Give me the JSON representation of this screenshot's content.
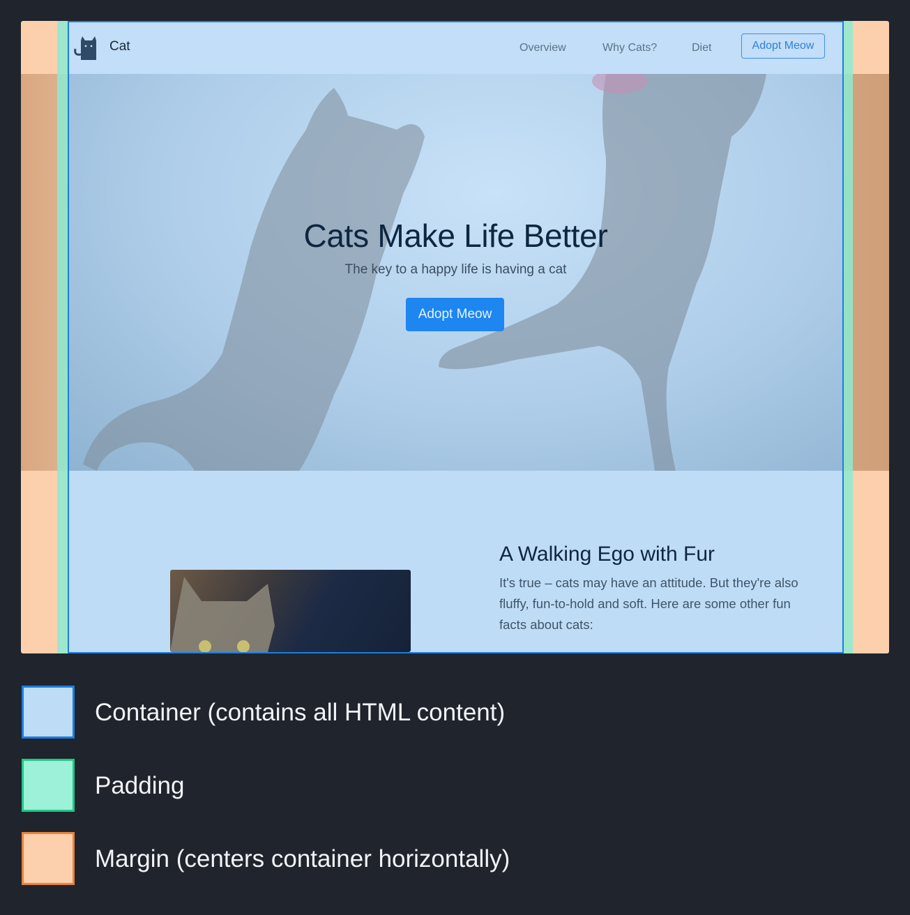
{
  "navbar": {
    "brand": "Cat",
    "links": [
      "Overview",
      "Why Cats?",
      "Diet"
    ],
    "cta": "Adopt Meow"
  },
  "hero": {
    "title": "Cats Make Life Better",
    "subtitle": "The key to a happy life is having a cat",
    "button": "Adopt Meow"
  },
  "section": {
    "title": "A Walking Ego with Fur",
    "body": "It's true – cats may have an attitude. But they're also fluffy, fun-to-hold and soft. Here are some other fun facts about cats:"
  },
  "legend": {
    "items": [
      {
        "label": "Container (contains all HTML content)",
        "color": "#1a7ee0",
        "fill": "#bfdcf7"
      },
      {
        "label": "Padding",
        "color": "#1fc98a",
        "fill": "#9df1d8"
      },
      {
        "label": "Margin (centers container horizontally)",
        "color": "#e8843c",
        "fill": "#fdd0ad"
      }
    ]
  },
  "colors": {
    "background": "#20242c",
    "primary": "#1d86f0"
  }
}
